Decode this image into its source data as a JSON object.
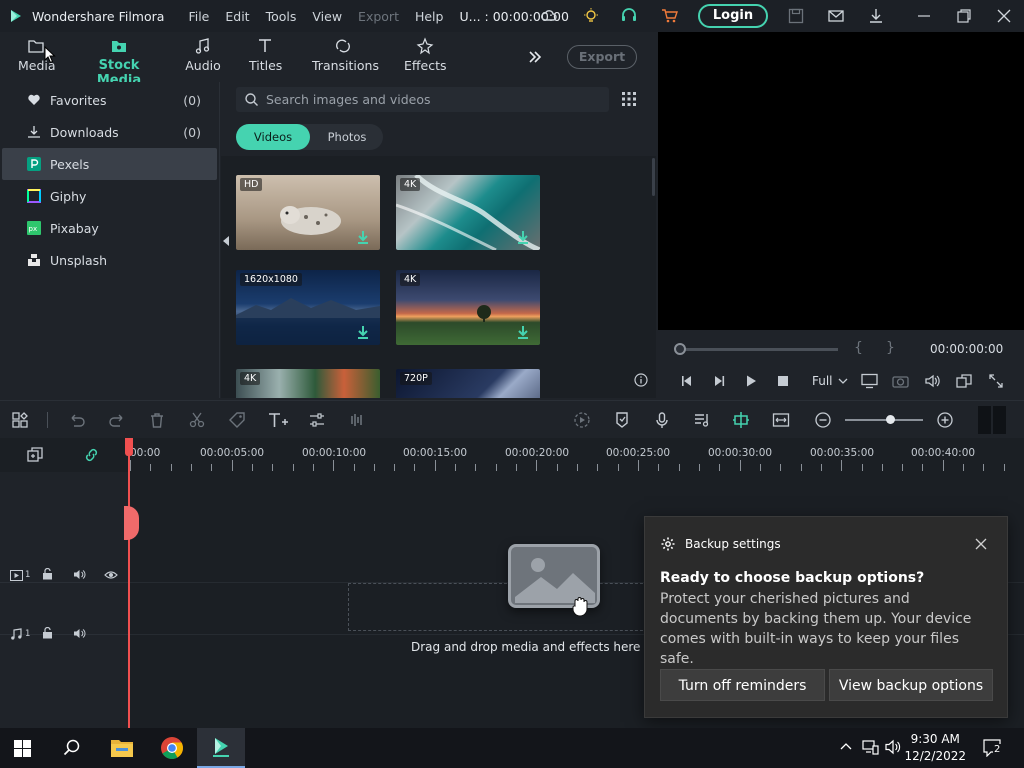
{
  "titlebar": {
    "app_name": "Wondershare Filmora",
    "menu": [
      "File",
      "Edit",
      "Tools",
      "View",
      "Export",
      "Help"
    ],
    "timecode": "U... : 00:00:00:00",
    "login_label": "Login"
  },
  "media_tabs": [
    {
      "label": "Media"
    },
    {
      "label": "Stock Media"
    },
    {
      "label": "Audio"
    },
    {
      "label": "Titles"
    },
    {
      "label": "Transitions"
    },
    {
      "label": "Effects"
    }
  ],
  "export_label": "Export",
  "sidebar": {
    "items": [
      {
        "label": "Favorites",
        "count": "(0)"
      },
      {
        "label": "Downloads",
        "count": "(0)"
      },
      {
        "label": "Pexels",
        "count": ""
      },
      {
        "label": "Giphy",
        "count": ""
      },
      {
        "label": "Pixabay",
        "count": ""
      },
      {
        "label": "Unsplash",
        "count": ""
      }
    ]
  },
  "search": {
    "placeholder": "Search images and videos"
  },
  "segment": {
    "videos": "Videos",
    "photos": "Photos"
  },
  "thumbnails": [
    {
      "badge": "HD"
    },
    {
      "badge": "4K"
    },
    {
      "badge": "1620x1080"
    },
    {
      "badge": "4K"
    },
    {
      "badge": "4K"
    },
    {
      "badge": "720P"
    }
  ],
  "player": {
    "timecode": "00:00:00:00",
    "quality": "Full"
  },
  "ruler_labels": [
    "00:00",
    "00:00:05:00",
    "00:00:10:00",
    "00:00:15:00",
    "00:00:20:00",
    "00:00:25:00",
    "00:00:30:00",
    "00:00:35:00",
    "00:00:40:00"
  ],
  "tracks": {
    "video_index": "1",
    "audio_index": "1"
  },
  "drop_text": "Drag and drop media and effects here to c",
  "toast": {
    "header": "Backup settings",
    "title": "Ready to choose backup options?",
    "body": "Protect your cherished pictures and documents by backing them up. Your device comes with built-in ways to keep your files safe.",
    "btn_off": "Turn off reminders",
    "btn_view": "View backup options"
  },
  "taskbar": {
    "time": "9:30 AM",
    "date": "12/2/2022",
    "notification_count": "2"
  },
  "colors": {
    "accent": "#45d3b0",
    "playhead": "#f05050"
  }
}
